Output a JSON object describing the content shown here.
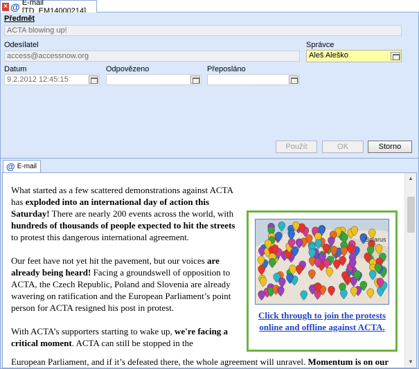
{
  "tab": {
    "title": "E-mail [TD_EM14000214]"
  },
  "form": {
    "subject_label": "Předmět",
    "subject_value": "ACTA blowing up!",
    "sender_label": "Odesílatel",
    "sender_value": "access@accessnow.org",
    "manager_label": "Správce",
    "manager_value": "Aleš Aleško",
    "date_label": "Datum",
    "date_value": "9.2.2012 12:45:15",
    "replied_label": "Odpovězeno",
    "replied_value": "",
    "forwarded_label": "Přeposláno",
    "forwarded_value": ""
  },
  "buttons": {
    "use": "Použít",
    "ok": "OK",
    "cancel": "Storno"
  },
  "email_tab": {
    "label": "E-mail"
  },
  "body": {
    "p1_a": "What started as a few scattered demonstrations against ACTA has ",
    "p1_b": "exploded into an international day of action this Saturday!",
    "p1_c": " There are nearly 200 events across the world, with ",
    "p1_d": "hundreds of thousands of people expected to hit the streets",
    "p1_e": " to protest this dangerous international agreement.",
    "p2_a": "Our feet have not yet hit the pavement, but our voices ",
    "p2_b": "are already being heard!",
    "p2_c": " Facing a groundswell of opposition to ACTA, the Czech Republic, Poland and Slovenia are already wavering on ratification and the European Parliament’s point person for ACTA resigned his post in protest.",
    "p3_a": "With ACTA’s supporters starting to wake up, ",
    "p3_b": "we're facing a critical moment",
    "p3_c": ". ACTA can still be stopped in the",
    "last_a": "European Parliament, and if it’s defeated there, the whole agreement will unravel. ",
    "last_b": "Momentum is on our",
    "map_caption": "Click through to join the protests online and offline against ACTA.",
    "map_labels": {
      "belarus": "Belarus"
    }
  }
}
